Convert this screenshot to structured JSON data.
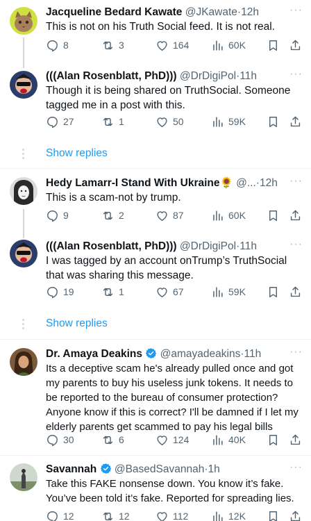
{
  "tweets": [
    {
      "name": "Jacqueline Bedard Kawate",
      "handle": "@JKawate",
      "time": "12h",
      "text": "This is not on his Truth Social feed.  It is not real.",
      "replies": "8",
      "retweets": "3",
      "likes": "164",
      "views": "60K"
    },
    {
      "name": "(((Alan Rosenblatt, PhD)))",
      "handle": "@DrDigiPol",
      "time": "11h",
      "text": "Though it is being shared on TruthSocial. Someone tagged me in a post with this.",
      "replies": "27",
      "retweets": "1",
      "likes": "50",
      "views": "59K"
    },
    {
      "name": "Hedy Lamarr-I Stand With Ukraine",
      "handle": "@...",
      "time": "12h",
      "text": "This is a scam-not by trump.",
      "replies": "9",
      "retweets": "2",
      "likes": "87",
      "views": "60K"
    },
    {
      "name": "(((Alan Rosenblatt, PhD)))",
      "handle": "@DrDigiPol",
      "time": "11h",
      "text": "I was tagged by an account onTrump’s TruthSocial that was sharing this message.",
      "replies": "19",
      "retweets": "1",
      "likes": "67",
      "views": "59K"
    },
    {
      "name": "Dr. Amaya Deakins",
      "handle": "@amayadeakins",
      "time": "11h",
      "text": "Its a deceptive scam he's already pulled once and got my parents to buy his useless junk tokens. It needs to be reported to the bureau of consumer protection? Anyone know if this is correct? I'll be damned if I let my elderly parents get scammed to pay his legal bills",
      "replies": "30",
      "retweets": "6",
      "likes": "124",
      "views": "40K"
    },
    {
      "name": "Savannah",
      "handle": "@BasedSavannah",
      "time": "1h",
      "text": "Take this FAKE nonsense down. You know it’s fake. You’ve been told it’s fake. Reported for spreading lies.",
      "replies": "12",
      "retweets": "12",
      "likes": "112",
      "views": "12K"
    }
  ],
  "show_replies_label": "Show replies",
  "separator_dot": "·",
  "more_label": "···",
  "sunflower_emoji": "🌻",
  "colors": {
    "link": "#1d9bf0",
    "verified": "#1d9bf0",
    "muted": "#536471",
    "divider": "#eff3f4"
  }
}
